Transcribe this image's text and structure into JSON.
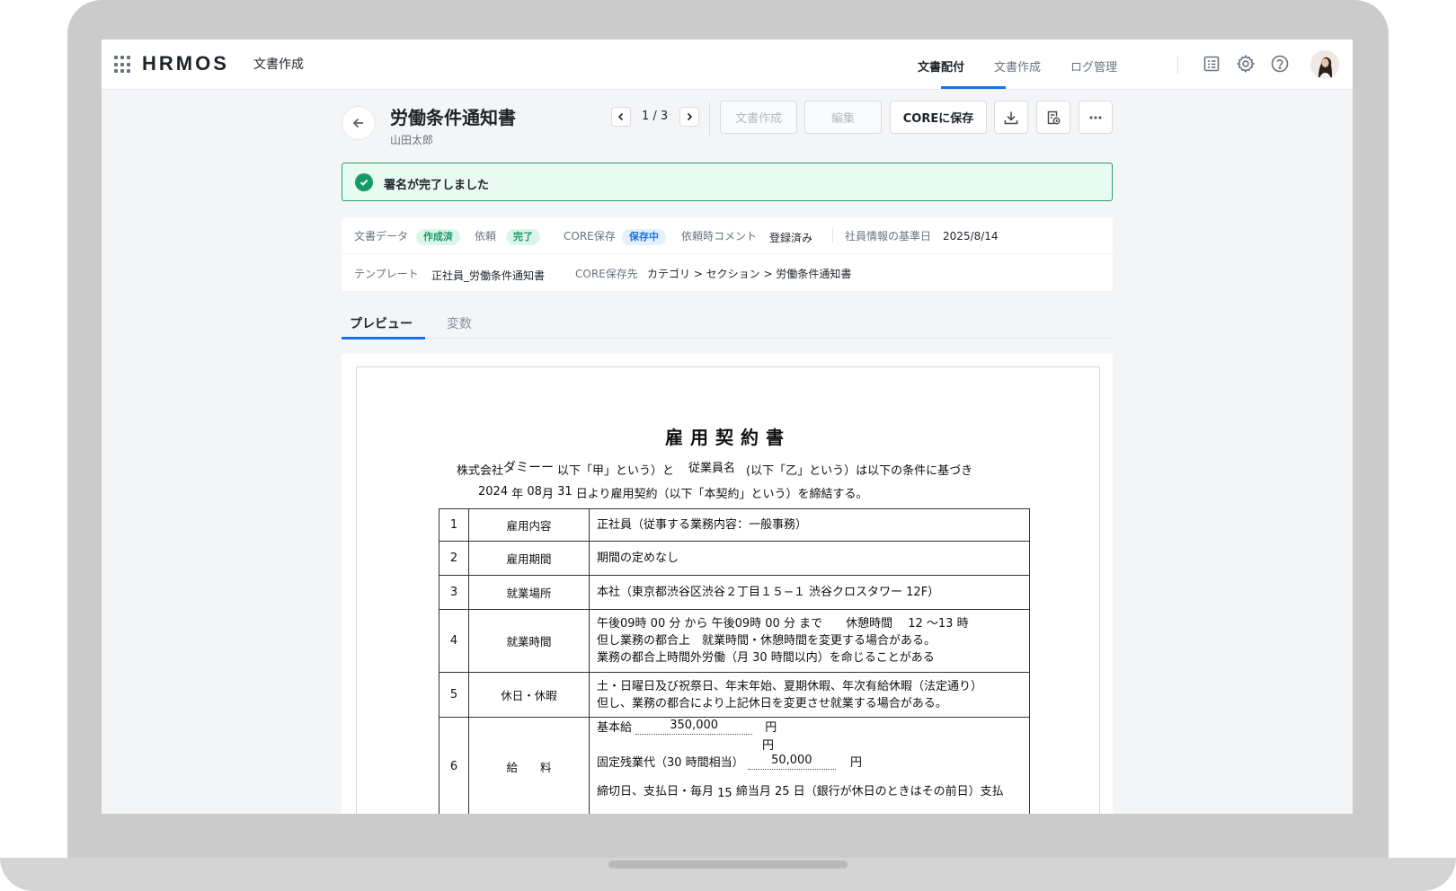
{
  "header": {
    "brand": "HRMOS",
    "brand_sub": "文書作成",
    "nav": [
      "文書配付",
      "文書作成",
      "ログ管理"
    ],
    "active_nav": "文書配付",
    "icons": [
      "document-list-icon",
      "gear-icon",
      "help-icon"
    ]
  },
  "document": {
    "title": "労働条件通知書",
    "owner": "山田太郎",
    "pager": "1 / 3",
    "buttons": {
      "create": "文書作成",
      "edit": "編集",
      "save_core": "COREに保存"
    }
  },
  "alert": {
    "message": "署名が完了しました"
  },
  "meta": {
    "data_label": "文書データ",
    "data_status": "作成済",
    "request_label": "依頼",
    "request_status": "完了",
    "core_label": "CORE保存",
    "core_status": "保存中",
    "comment_label": "依頼時コメント",
    "comment_value": "登録済み",
    "base_date_label": "社員情報の基準日",
    "base_date_value": "2025/8/14",
    "template_label": "テンプレート",
    "template_value": "正社員_労働条件通知書",
    "dest_label": "CORE保存先",
    "dest_value": "カテゴリ > セクション > 労働条件通知書"
  },
  "tabs": [
    "プレビュー",
    "変数"
  ],
  "contract": {
    "title": "雇用契約書",
    "intro_line1_a": "株式会社",
    "intro_line1_company": "ダミーー",
    "intro_line1_b": "以下「甲」という）と",
    "intro_line1_employee": "従業員名",
    "intro_line1_c": "(以下「乙」という）は以下の条件に基づき",
    "intro_line2_year": "2024",
    "intro_line2_a": "年",
    "intro_line2_month": "08",
    "intro_line2_b": "月",
    "intro_line2_day": "31",
    "intro_line2_c": "日より雇用契約（以下「本契約」という）を締結する。",
    "rows": [
      {
        "no": "1",
        "item": "雇用内容",
        "body": [
          "正社員（従事する業務内容：一般事務）"
        ]
      },
      {
        "no": "2",
        "item": "雇用期間",
        "body": [
          "期間の定めなし"
        ]
      },
      {
        "no": "3",
        "item": "就業場所",
        "body": [
          "本社（東京都渋谷区渋谷２丁目１５−１ 渋谷クロスタワー 12F）"
        ]
      },
      {
        "no": "4",
        "item": "就業時間",
        "body": [
          "午後09時 00 分 から 午後09時 00 分 まで　　休憩時間　 12 ～13 時",
          "但し業務の都合上　就業時間・休憩時間を変更する場合がある。",
          "業務の都合上時間外労働（月 30 時間以内）を命じることがある"
        ]
      },
      {
        "no": "5",
        "item": "休日・休暇",
        "body": [
          "土・日曜日及び祝祭日、年末年始、夏期休暇、年次有給休暇（法定通り）",
          "但し、業務の都合により上記休日を変更させ就業する場合がある。"
        ]
      },
      {
        "no": "6",
        "item": "給　　料",
        "body": []
      }
    ],
    "salary": {
      "base_label": "基本給",
      "base_value": "350,000",
      "yen": "円",
      "overtime_label": "固定残業代（30 時間相当）",
      "overtime_value": "50,000",
      "pay_a": "締切日、支払日・毎月",
      "pay_close": "15",
      "pay_b": "締当月 25 日（銀行が休日のときはその前日）支払"
    }
  }
}
